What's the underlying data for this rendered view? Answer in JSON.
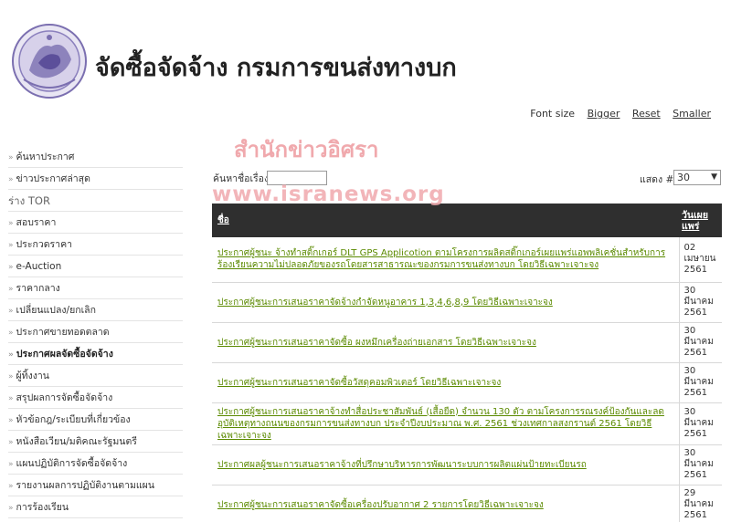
{
  "header": {
    "site_title": "จัดซื้อจัดจ้าง กรมการขนส่งทางบก"
  },
  "font_controls": {
    "label": "Font size",
    "bigger": "Bigger",
    "reset": "Reset",
    "smaller": "Smaller"
  },
  "watermark": {
    "line1": "สำนักข่าวอิศรา",
    "line2": "www.isranews.org"
  },
  "sidebar": {
    "items": [
      {
        "label": "ค้นหาประกาศ"
      },
      {
        "label": "ข่าวประกาศล่าสุด"
      },
      {
        "label": "ร่าง TOR"
      },
      {
        "label": "สอบราคา"
      },
      {
        "label": "ประกวดราคา"
      },
      {
        "label": "e-Auction"
      },
      {
        "label": "ราคากลาง"
      },
      {
        "label": "เปลี่ยนแปลง/ยกเลิก"
      },
      {
        "label": "ประกาศขายทอดตลาด"
      },
      {
        "label": "ประกาศผลจัดซื้อจัดจ้าง"
      },
      {
        "label": "ผู้ทิ้งงาน"
      },
      {
        "label": "สรุปผลการจัดซื้อจัดจ้าง"
      },
      {
        "label": "หัวข้อกฎ/ระเบียบที่เกี่ยวข้อง"
      },
      {
        "label": "หนังสือเวียน/มติคณะรัฐมนตรี"
      },
      {
        "label": "แผนปฏิบัติการจัดซื้อจัดจ้าง"
      },
      {
        "label": "รายงานผลการปฏิบัติงานตามแผน"
      },
      {
        "label": "การร้องเรียน"
      }
    ]
  },
  "search": {
    "label": "ค้นหาชื่อเรื่อง",
    "value": ""
  },
  "display": {
    "label": "แสดง #",
    "selected": "30"
  },
  "table": {
    "headers": {
      "title": "ชื่อ",
      "date": "วันเผยแพร่"
    },
    "rows": [
      {
        "title": "ประกาศผู้ชนะ จ้างทำสติ๊กเกอร์ DLT GPS Applicotion ตามโครงการผลิตสติ๊กเกอร์เผยแพร่แอพพลิเคชั่นสำหรับการร้องเรียนความไม่ปลอดภัยของรถโดยสารสาธารณะของกรมการขนส่งทางบก โดยวิธีเฉพาะเจาะจง",
        "day": "02",
        "month": "เมษายน",
        "year": "2561"
      },
      {
        "title": "ประกาศผู้ชนะการเสนอราคาจัดจ้างกำจัดหนูอาคาร 1,3,4,6,8,9 โดยวิธีเฉพาะเจาะจง",
        "day": "30",
        "month": "มีนาคม",
        "year": "2561"
      },
      {
        "title": "ประกาศผู้ชนะการเสนอราคาจัดซื้อ ผงหมึกเครื่องถ่ายเอกสาร โดยวิธีเฉพาะเจาะจง",
        "day": "30",
        "month": "มีนาคม",
        "year": "2561"
      },
      {
        "title": "ประกาศผู้ชนะการเสนอราคาจัดซื้อวัสดุคอมพิวเตอร์ โดยวิธีเฉพาะเจาะจง",
        "day": "30",
        "month": "มีนาคม",
        "year": "2561"
      },
      {
        "title": "ประกาศผู้ชนะการเสนอราคาจ้างทำสื่อประชาสัมพันธ์ (เสื้อยืด) จำนวน 130 ตัว ตามโครงการรณรงค์ป้องกันและลดอุบัติเหตุทางถนนของกรมการขนส่งทางบก ประจำปีงบประมาณ พ.ศ. 2561 ช่วงเทศกาลสงกรานต์ 2561 โดยวิธีเฉพาะเจาะจง",
        "day": "30",
        "month": "มีนาคม",
        "year": "2561"
      },
      {
        "title": "ประกาศผลผู้ชนะการเสนอราคาจ้างที่ปรึกษาบริหารการพัฒนาระบบการผลิตแผ่นป้ายทะเบียนรถ",
        "day": "30",
        "month": "มีนาคม",
        "year": "2561"
      },
      {
        "title": "ประกาศผู้ชนะการเสนอราคาจัดซื้อเครื่องปรับอากาศ 2 รายการโดยวิธีเฉพาะเจาะจง",
        "day": "29",
        "month": "มีนาคม",
        "year": "2561"
      }
    ]
  },
  "colors": {
    "link_green": "#5b8a00",
    "header_dark": "#2f2f2f",
    "watermark_pink": "#f0a9ad",
    "logo_purple": "#7b6fb0"
  }
}
